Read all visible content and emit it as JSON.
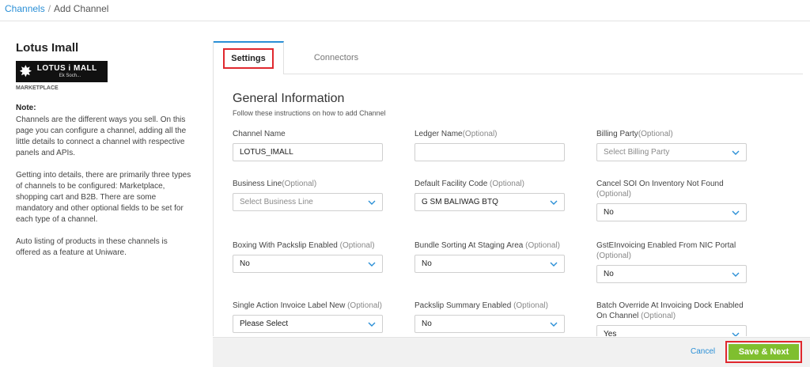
{
  "breadcrumb": {
    "parent": "Channels",
    "separator": "/",
    "current": "Add Channel"
  },
  "channel": {
    "name": "Lotus Imall",
    "logo_text": "LOTUS i MALL",
    "logo_tagline": "Ek Soch...",
    "type": "MARKETPLACE"
  },
  "note": {
    "title": "Note:",
    "p1": "Channels are the different ways you sell. On this page you can configure a channel, adding all the little details to connect a channel with respective panels and APIs.",
    "p2": "Getting into details, there are primarily three types of channels to be configured: Marketplace, shopping cart and B2B. There are some mandatory and other optional fields to be set for each type of a channel.",
    "p3": "Auto listing of products in these channels is offered as a feature at Uniware."
  },
  "tabs": {
    "settings": "Settings",
    "connectors": "Connectors"
  },
  "section": {
    "title": "General Information",
    "subtitle": "Follow these instructions on how to add Channel"
  },
  "fields": {
    "channel_name": {
      "label": "Channel Name",
      "value": "LOTUS_IMALL"
    },
    "ledger_name": {
      "label": "Ledger Name",
      "opt": "(Optional)",
      "value": ""
    },
    "billing_party": {
      "label": "Billing Party",
      "opt": "(Optional)",
      "value": "Select Billing Party"
    },
    "business_line": {
      "label": "Business Line",
      "opt": "(Optional)",
      "value": "Select Business Line"
    },
    "default_facility": {
      "label": "Default Facility Code",
      "opt": "(Optional)",
      "value": "G SM BALIWAG BTQ"
    },
    "cancel_soi": {
      "label": "Cancel SOI On Inventory Not Found",
      "opt": "(Optional)",
      "value": "No"
    },
    "boxing_packslip": {
      "label": "Boxing With Packslip Enabled",
      "opt": "(Optional)",
      "value": "No"
    },
    "bundle_sorting": {
      "label": "Bundle Sorting At Staging Area",
      "opt": "(Optional)",
      "value": "No"
    },
    "gst_einvoicing": {
      "label": "GstEInvoicing Enabled From NIC Portal",
      "opt": "(Optional)",
      "value": "No"
    },
    "single_action_label": {
      "label": "Single Action Invoice Label New",
      "opt": "(Optional)",
      "value": "Please Select"
    },
    "packslip_summary": {
      "label": "Packslip Summary Enabled",
      "opt": "(Optional)",
      "value": "No"
    },
    "batch_override": {
      "label": "Batch Override At Invoicing Dock Enabled On Channel",
      "opt": "(Optional)",
      "value": "Yes"
    }
  },
  "footer": {
    "cancel": "Cancel",
    "save": "Save & Next"
  },
  "colors": {
    "accent": "#2a8fd6",
    "save": "#7fbf2f",
    "highlight": "#e0282e"
  }
}
